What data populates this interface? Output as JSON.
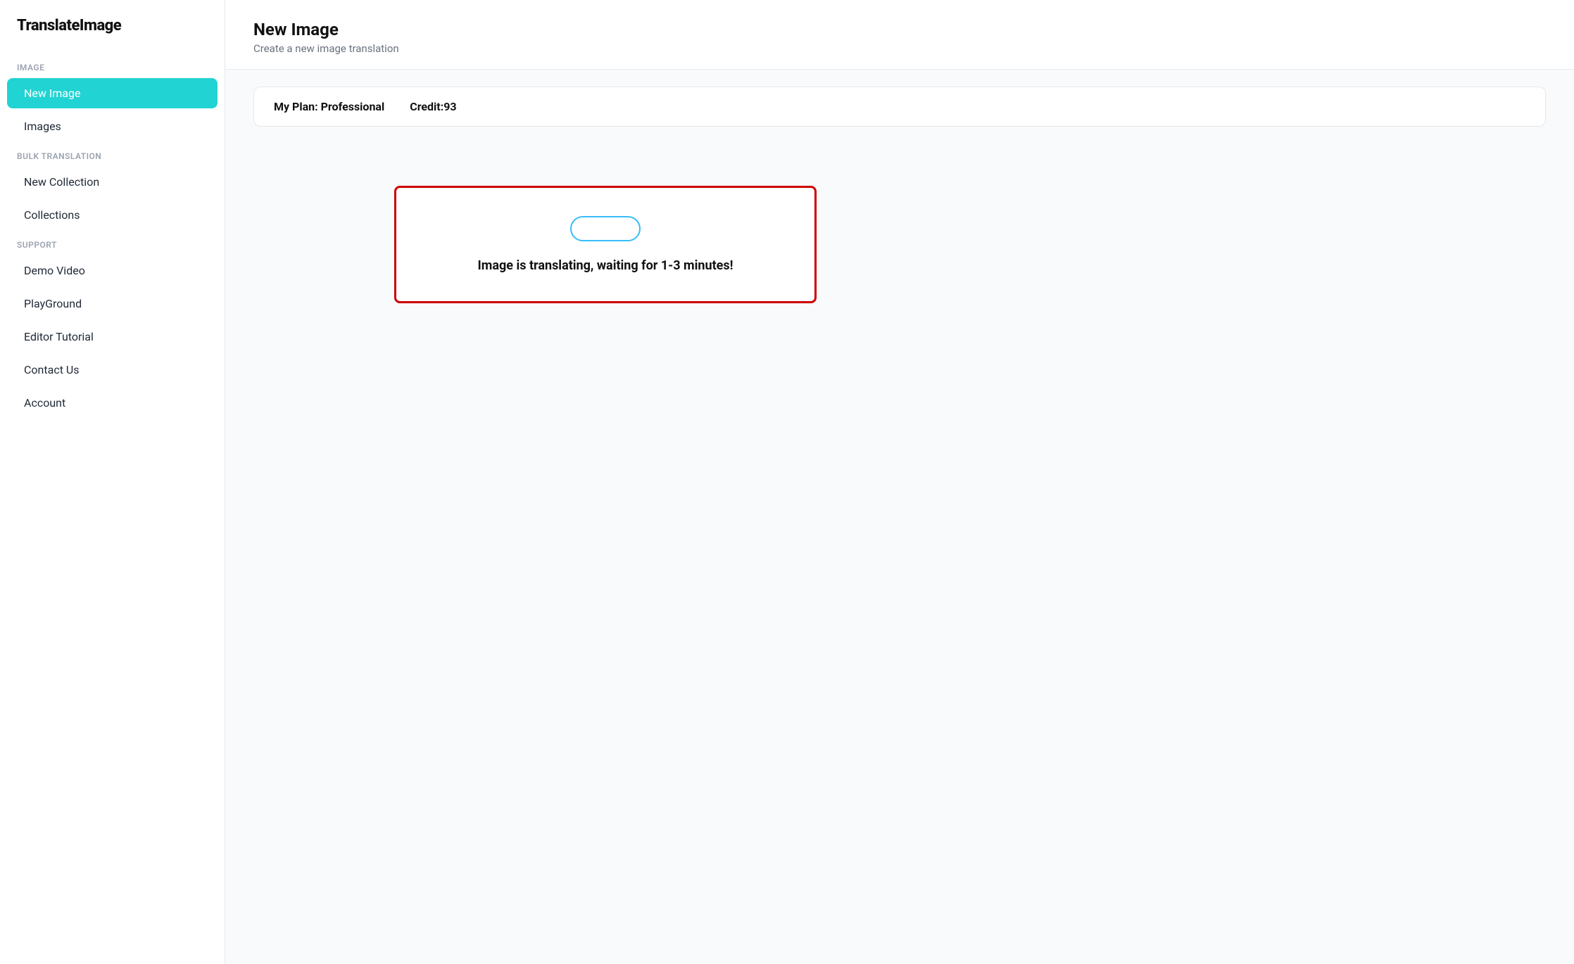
{
  "app": {
    "logo": "TranslateImage"
  },
  "sidebar": {
    "sections": [
      {
        "label": "IMAGE",
        "items": [
          {
            "id": "new-image",
            "text": "New Image",
            "active": true
          },
          {
            "id": "images",
            "text": "Images",
            "active": false
          }
        ]
      },
      {
        "label": "BULK TRANSLATION",
        "items": [
          {
            "id": "new-collection",
            "text": "New Collection",
            "active": false
          },
          {
            "id": "collections",
            "text": "Collections",
            "active": false
          }
        ]
      },
      {
        "label": "SUPPORT",
        "items": [
          {
            "id": "demo-video",
            "text": "Demo Video",
            "active": false
          },
          {
            "id": "playground",
            "text": "PlayGround",
            "active": false
          },
          {
            "id": "editor-tutorial",
            "text": "Editor Tutorial",
            "active": false
          },
          {
            "id": "contact-us",
            "text": "Contact Us",
            "active": false
          },
          {
            "id": "account",
            "text": "Account",
            "active": false
          }
        ]
      }
    ]
  },
  "main": {
    "title": "New Image",
    "subtitle": "Create a new image translation",
    "plan": {
      "label": "My Plan: Professional",
      "credit": "Credit:93"
    },
    "status": {
      "message": "Image is translating, waiting for 1-3 minutes!"
    }
  }
}
